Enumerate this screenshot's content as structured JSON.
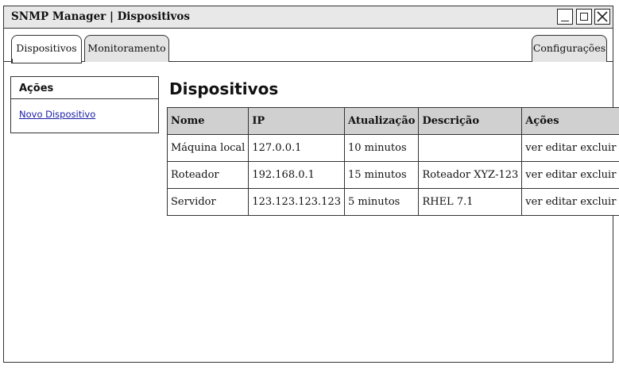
{
  "window": {
    "title": "SNMP Manager | Dispositivos",
    "controls": {
      "minimize": "minimize-icon",
      "maximize": "maximize-icon",
      "close": "close-icon"
    }
  },
  "tabs": [
    {
      "label": "Dispositivos",
      "active": true
    },
    {
      "label": "Monitoramento",
      "active": false
    }
  ],
  "config_tab": {
    "label": "Configurações"
  },
  "sidebar": {
    "title": "Ações",
    "link": "Novo Dispositivo"
  },
  "main": {
    "title": "Dispositivos",
    "table": {
      "headers": [
        "Nome",
        "IP",
        "Atualização",
        "Descrição",
        "Ações"
      ],
      "rows": [
        {
          "nome": "Máquina local",
          "ip": "127.0.0.1",
          "atualizacao": "10 minutos",
          "descricao": ""
        },
        {
          "nome": "Roteador",
          "ip": "192.168.0.1",
          "atualizacao": "15 minutos",
          "descricao": "Roteador XYZ-123"
        },
        {
          "nome": "Servidor",
          "ip": "123.123.123.123",
          "atualizacao": "5 minutos",
          "descricao": "RHEL 7.1"
        }
      ],
      "actions": {
        "view": "ver",
        "edit": "editar",
        "delete": "excluir"
      }
    }
  },
  "colors": {
    "header_bg": "#d0d0d0",
    "titlebar_bg": "#e8e8e8",
    "link": "#1a1aa6"
  }
}
